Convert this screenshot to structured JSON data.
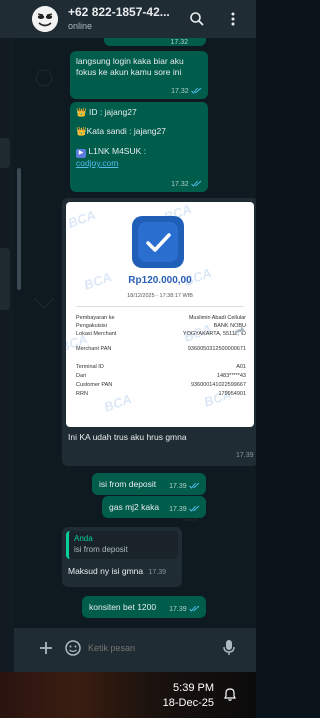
{
  "header": {
    "contact_name": "+62 822-1857-42...",
    "status": "online",
    "avatar_icon": "meme-face-avatar",
    "search_icon": "search-icon",
    "menu_icon": "kebab-menu-icon"
  },
  "messages": [
    {
      "text": "17.32",
      "kind": "out-time-clipped"
    },
    {
      "text": "langsung login kaka biar aku fokus ke akun kamu sore ini",
      "time": "17.32"
    },
    {
      "line1_prefix": "👑",
      "line1": " ID : jajang27",
      "line2_prefix": "👑",
      "line2": "Kata sandi : jajang27",
      "line3_prefix": "▶",
      "line3": " L1NK M4SUK :",
      "link": "codjoy.com",
      "time": "17.32"
    },
    {
      "caption": "Ini KA udah trus aku hrus gmna",
      "time": "17.39"
    },
    {
      "text": "isi from deposit",
      "time": "17.39"
    },
    {
      "text": "gas mj2 kaka",
      "time": "17.39"
    },
    {
      "quote_author": "Anda",
      "quote_text": "isi from deposit",
      "text": "Maksud ny isi gmna",
      "time": "17.39"
    },
    {
      "text": "konsiten bet 1200",
      "time": "17.39"
    }
  ],
  "receipt": {
    "logo_text": "BCA",
    "amount": "Rp120.000,00",
    "datetime": "18/12/2025 - 17:38:17 WIB",
    "rows": [
      {
        "k": "Pembayaran ke",
        "v": "Muslimin Abadi Cellular"
      },
      {
        "k": "Pengakuisisi",
        "v": "BANK NOBU"
      },
      {
        "k": "Lokasi Merchant",
        "v": "YOGYAKARTA, 55111, ID"
      },
      {
        "k": "Merchant PAN",
        "v": "9360050312500000671"
      },
      {
        "k": "Terminal ID",
        "v": "A01"
      },
      {
        "k": "Dari",
        "v": "1483*****43"
      },
      {
        "k": "Customer PAN",
        "v": "936000141022599667"
      },
      {
        "k": "RRN",
        "v": "179954901"
      }
    ]
  },
  "composer": {
    "placeholder": "Ketik pesan",
    "add_icon": "plus-icon",
    "emoji_icon": "sticker-icon",
    "mic_icon": "mic-icon"
  },
  "taskbar": {
    "time": "5:39 PM",
    "date": "18-Dec-25",
    "notification_icon": "notification-icon"
  },
  "colors": {
    "outgoing_bubble": "#005c4b",
    "incoming_bubble": "#202c33",
    "header": "#1f2c33",
    "link": "#53bdeb",
    "check_blue": "#53bdeb"
  }
}
